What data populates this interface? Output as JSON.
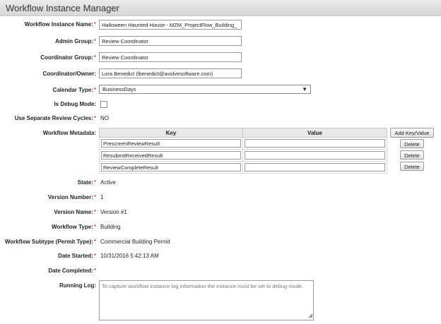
{
  "window": {
    "title": "Workflow Instance Manager"
  },
  "form": {
    "instance_name": {
      "label": "Workflow Instance Name:",
      "required": "*",
      "value": "Halloween Haunted House - MZM_ProjectFlow_Building_"
    },
    "admin_group": {
      "label": "Admin Group:",
      "required": "*",
      "value": "Review Coordinator"
    },
    "coordinator_group": {
      "label": "Coordinator Group:",
      "required": "*",
      "value": "Review Coordinator"
    },
    "coordinator_owner": {
      "label": "Coordinator/Owner:",
      "value": "Lora Benedict (lbenedict@avolvesoftware.com)"
    },
    "calendar_type": {
      "label": "Calendar Type:",
      "required": "*",
      "value": "BusinessDays"
    },
    "debug_mode": {
      "label": "Is Debug Mode:",
      "checked": false
    },
    "separate_review": {
      "label": "Use Separate Review Cycles:",
      "required": "*",
      "value": "NO"
    },
    "metadata": {
      "label": "Workflow Metadata:",
      "col_key": "Key",
      "col_value": "Value",
      "add_label": "Add Key/Value",
      "delete_label": "Delete",
      "rows": [
        {
          "key": "PrescreenReviewResult",
          "value": ""
        },
        {
          "key": "ResubmitReceivedResult",
          "value": ""
        },
        {
          "key": "ReviewCompleteResult",
          "value": ""
        }
      ]
    },
    "state": {
      "label": "State:",
      "required": "*",
      "value": "Active"
    },
    "version_number": {
      "label": "Version Number:",
      "required": "*",
      "value": "1"
    },
    "version_name": {
      "label": "Version Name:",
      "required": "*",
      "value": "Version #1"
    },
    "workflow_type": {
      "label": "Workflow Type:",
      "required": "*",
      "value": "Building"
    },
    "workflow_subtype": {
      "label": "Workflow Subtype (Permit Type):",
      "required": "*",
      "value": "Commercial Building Permit"
    },
    "date_started": {
      "label": "Date Started:",
      "required": "*",
      "value": "10/31/2016 5:42:13 AM"
    },
    "date_completed": {
      "label": "Date Completed:",
      "required": "*",
      "value": ""
    },
    "running_log": {
      "label": "Running Log:",
      "placeholder": "To capture workflow instance log information the instance must be set to debug mode."
    }
  }
}
